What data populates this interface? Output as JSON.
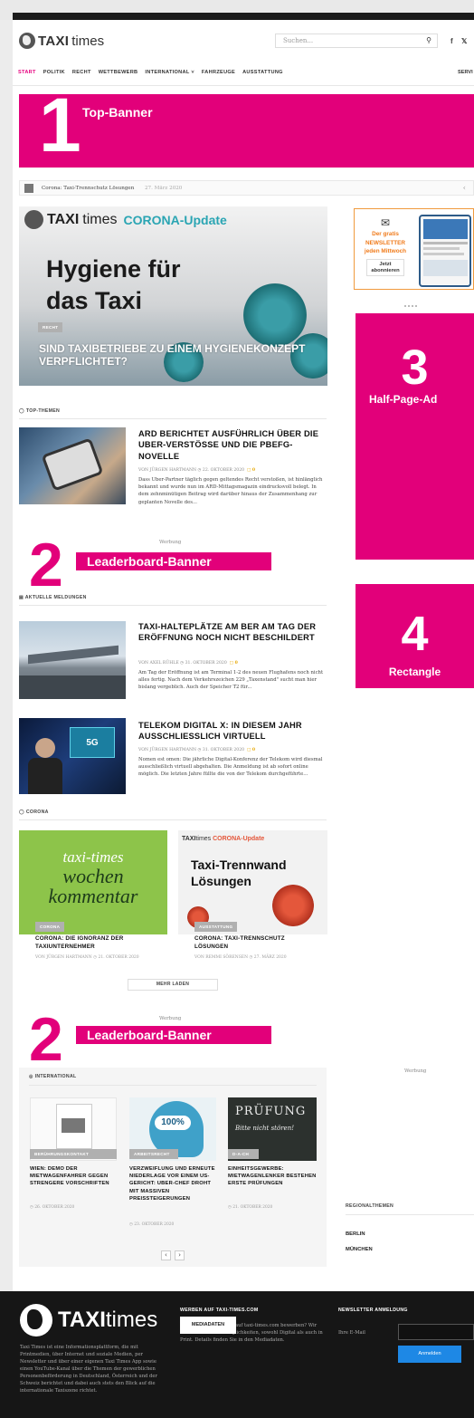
{
  "header": {
    "logo_text": "TAXI",
    "logo_text2": "times",
    "search_placeholder": "Suchen...",
    "social": [
      "f",
      "𝕏"
    ]
  },
  "nav": {
    "items": [
      "START",
      "POLITIK",
      "RECHT",
      "WETTBEWERB",
      "INTERNATIONAL ˅",
      "FAHRZEUGE",
      "AUSSTATTUNG"
    ],
    "right": "SERVI"
  },
  "banner1": {
    "num": "1",
    "label": "Top-Banner"
  },
  "ticker": {
    "text": "Corona: Taxi-Trennschutz Lösungen",
    "date": "27. März 2020",
    "arrow": "‹"
  },
  "hero": {
    "brand": "TAXI",
    "brand2": "times",
    "update": "CORONA-Update",
    "headline_line1": "Hygiene für",
    "headline_line2": "das Taxi",
    "tag": "RECHT",
    "caption": "SIND TAXIBETRIEBE ZU EINEM HYGIENEKONZEPT VERPFLICHTET?"
  },
  "topthemen": {
    "heading": "TOP-THEMEN",
    "title": "ARD BERICHTET AUSFÜHRLICH ÜBER DIE UBER-VERSTÖSSE UND DIE PBEFG-NOVELLE",
    "meta": "VON JÜRGEN HARTMANN   ◷ 22. OKTOBER 2020",
    "comments": "0",
    "excerpt": "Dass Uber-Partner täglich gegen geltendes Recht verstoßen, ist hinlänglich bekannt und wurde nun im ARD-Mittagsmagazin eindrucksvoll belegt. In dem zehnminütigen Beitrag wird darüber hinaus der Zusammenhang zur geplanten Novelle des..."
  },
  "werbung": "Werbung",
  "leaderboard": {
    "num": "2",
    "label": "Leaderboard-Banner"
  },
  "meldungen": {
    "heading": "AKTUELLE MELDUNGEN",
    "items": [
      {
        "title": "TAXI-HALTEPLÄTZE AM BER AM TAG DER ERÖFFNUNG NOCH NICHT BESCHILDERT",
        "meta": "VON AXEL RÜHLE   ◷ 31. OKTOBER 2020",
        "comments": "0",
        "excerpt": "Am Tag der Eröffnung ist am Terminal 1-2 des neuen Flughafens noch nicht alles fertig. Nach dem Verkehrszeichen 229 „Taxenstand\" sucht man hier bislang vergeblich. Auch der Speicher T2 für..."
      },
      {
        "title": "TELEKOM DIGITAL X: IN DIESEM JAHR AUSSCHLIESSLICH VIRTUELL",
        "meta": "VON JÜRGEN HARTMANN   ◷ 31. OKTOBER 2020",
        "comments": "0",
        "excerpt": "Nomen est omen: Die jährliche Digital-Konferenz der Telekom wird diesmal ausschließlich virtuell abgehalten. Die Anmeldung ist ab sofort online möglich.    Die letzten Jahre füllte die von der Telekom durchgeführte..."
      }
    ],
    "screen_5g": "5G"
  },
  "corona": {
    "heading": "CORONA",
    "cards": [
      {
        "img_line1": "taxi-times",
        "img_line2": "wochen",
        "img_line3": "kommentar",
        "tag": "CORONA",
        "title": "CORONA: DIE IGNORANZ DER TAXIUNTERNEHMER",
        "meta": "VON JÜRGEN HARTMANN   ◷ 21. OKTOBER 2020"
      },
      {
        "img_brand": "TAXI",
        "img_brand2": "times",
        "img_update": "CORONA-Update",
        "img_line1": "Taxi-Trennwand",
        "img_line2": "Lösungen",
        "tag": "AUSSTATTUNG",
        "title": "CORONA: TAXI-TRENNSCHUTZ LÖSUNGEN",
        "meta": "VON REMMI SÖRENSEN   ◷ 27. MÄRZ 2020"
      }
    ],
    "more": "MEHR LADEN"
  },
  "international": {
    "heading": "INTERNATIONAL",
    "items": [
      {
        "tag": "BERÜHRUNGSKONTAKT",
        "title": "WIEN: DEMO DER MIETWAGENFAHRER GEGEN STRENGERE VORSCHRIFTEN",
        "date": "◷ 26. OKTOBER 2020"
      },
      {
        "tag": "ARBEITSRECHT",
        "title": "VERZWEIFLUNG UND ERNEUTE NIEDERLAGE VOR EINEM US-GERICHT: UBER-CHEF DROHT MIT MASSIVEN PREISSTEIGERUNGEN",
        "date": "◷ 23. OKTOBER 2020",
        "img_text": "100%"
      },
      {
        "tag": "D-A-CH",
        "title": "EINHEITSGEWERBE: MIETWAGENLENKER BESTEHEN ERSTE PRÜFUNGEN",
        "date": "◷ 21. OKTOBER 2020",
        "img_line1": "PRÜFUNG",
        "img_line2": "Bitte nicht stören!"
      }
    ],
    "prev": "‹",
    "next": "›"
  },
  "sidebar": {
    "ad3": {
      "num": "3",
      "label": "Half-Page-Ad"
    },
    "ad4": {
      "num": "4",
      "label": "Rectangle"
    },
    "newsletter": {
      "line1": "Der gratis",
      "line2": "NEWSLETTER",
      "line3": "jeden Mittwoch",
      "btn1": "Jetzt",
      "btn2": "abonnieren"
    },
    "werbung": "Werbung",
    "regional_heading": "REGIONALTHEMEN",
    "regions": [
      "BERLIN",
      "MÜNCHEN"
    ]
  },
  "footer": {
    "logo": "TAXI",
    "logo2": "times",
    "about": "Taxi Times ist eine Informationsplattform, die mit Printmedien, über Internet und soziale Medien, per Newsletter und über einer eigenen Taxi Times App sowie einen YouTube-Kanal über die Themen der gewerblichen Personenbeförderung in Deutschland, Österreich und der Schweiz berichtet und dabei auch stets den Blick auf die internationale Taxiszene richtet.",
    "werben_heading": "WERBEN AUF TAXI-TIMES.COM",
    "werben_text": "Sie wollen Ihr Produkt auf taxi-times.com bewerben? Wir bieten Ihnen viele Möglichkeiten, sowohl Digital als auch in Print. Details finden Sie in den Mediadaten.",
    "mediadaten": "MEDIADATEN",
    "newsletter_heading": "NEWSLETTER ANMELDUNG",
    "email_label": "Ihre E-Mail",
    "subscribe": "Anmelden"
  }
}
